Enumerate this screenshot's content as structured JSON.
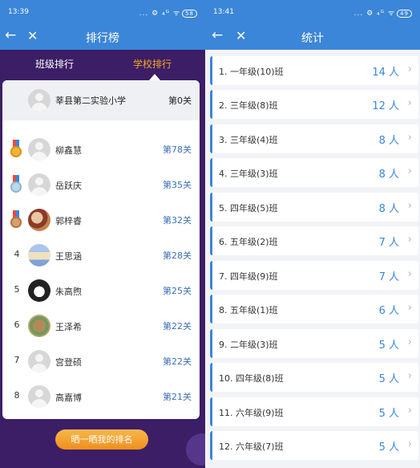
{
  "left": {
    "status": {
      "time": "13:39",
      "icons": "... ⚙ ₄ᴳ ᯤ",
      "battery": "58"
    },
    "appbar": {
      "title": "排行榜"
    },
    "tabs": {
      "class_rank": "班级排行",
      "school_rank": "学校排行"
    },
    "school": {
      "name": "莘县第二实验小学",
      "level": "第0关"
    },
    "rows": [
      {
        "rank": "",
        "medal": "gold",
        "name": "柳鑫慧",
        "level": "第78关"
      },
      {
        "rank": "",
        "medal": "silver",
        "name": "岳跃庆",
        "level": "第35关"
      },
      {
        "rank": "",
        "medal": "bronze",
        "name": "郭梓睿",
        "level": "第32关"
      },
      {
        "rank": "4",
        "medal": "",
        "name": "王思涵",
        "level": "第28关"
      },
      {
        "rank": "5",
        "medal": "",
        "name": "朱高煦",
        "level": "第25关"
      },
      {
        "rank": "6",
        "medal": "",
        "name": "王泽希",
        "level": "第22关"
      },
      {
        "rank": "7",
        "medal": "",
        "name": "宫登硕",
        "level": "第22关"
      },
      {
        "rank": "8",
        "medal": "",
        "name": "高嘉博",
        "level": "第21关"
      }
    ],
    "share_button": "晒一晒我的排名"
  },
  "right": {
    "status": {
      "time": "13:41",
      "icons": "... ⚙ ₄ᴳ ᯤ",
      "battery": "49"
    },
    "appbar": {
      "title": "统计"
    },
    "items": [
      {
        "label": "1. 一年级(10)班",
        "count": "14 人"
      },
      {
        "label": "2. 三年级(8)班",
        "count": "12 人"
      },
      {
        "label": "3. 三年级(4)班",
        "count": "8 人"
      },
      {
        "label": "4. 三年级(3)班",
        "count": "8 人"
      },
      {
        "label": "5. 四年级(5)班",
        "count": "8 人"
      },
      {
        "label": "6. 五年级(2)班",
        "count": "7 人"
      },
      {
        "label": "7. 四年级(9)班",
        "count": "7 人"
      },
      {
        "label": "8. 五年级(1)班",
        "count": "6 人"
      },
      {
        "label": "9. 二年级(3)班",
        "count": "5 人"
      },
      {
        "label": "10. 四年级(8)班",
        "count": "5 人"
      },
      {
        "label": "11. 六年级(9)班",
        "count": "5 人"
      },
      {
        "label": "12. 六年级(7)班",
        "count": "5 人"
      }
    ]
  },
  "colors": {
    "accent": "#3b86d8",
    "tab_active": "#f5a623",
    "left_bg": "#3b1e66"
  }
}
